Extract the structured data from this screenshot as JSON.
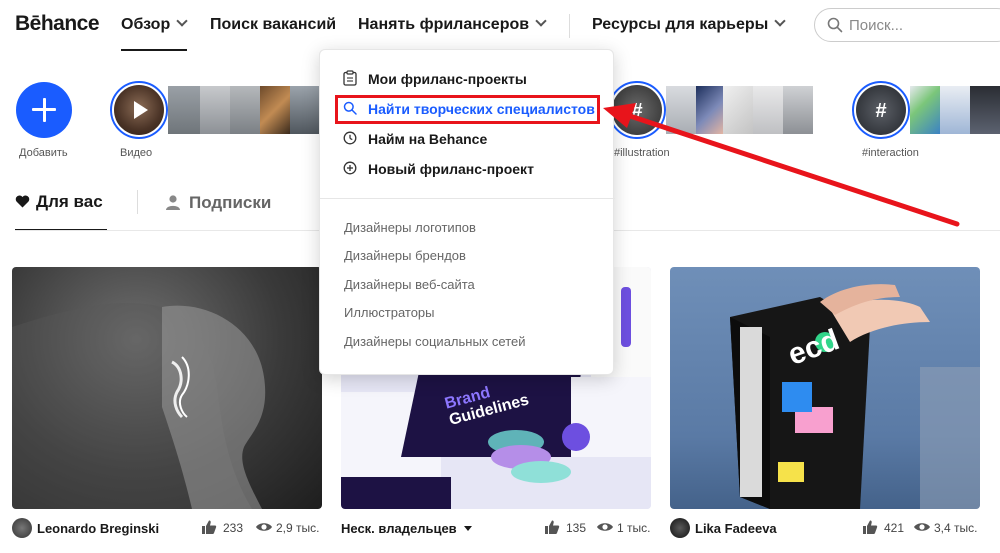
{
  "header": {
    "logo": "Bēhance",
    "nav": {
      "browse": "Обзор",
      "jobs": "Поиск вакансий",
      "hire": "Нанять фрилансеров",
      "career": "Ресурсы для карьеры"
    },
    "search_placeholder": "Поиск..."
  },
  "stories": {
    "add_label": "Добавить",
    "video_label": "Видео",
    "illustration_label": "#illustration",
    "interaction_label": "#interaction"
  },
  "tabs": {
    "for_you": "Для вас",
    "following": "Подписки"
  },
  "dropdown": {
    "items": [
      {
        "label": "Мои фриланс-проекты",
        "icon": "clipboard-icon"
      },
      {
        "label": "Найти творческих специалистов",
        "icon": "search-icon"
      },
      {
        "label": "Найм на Behance",
        "icon": "clock-icon"
      },
      {
        "label": "Новый фриланс-проект",
        "icon": "plus-circle-icon"
      }
    ],
    "subitems": [
      "Дизайнеры логотипов",
      "Дизайнеры брендов",
      "Дизайнеры веб-сайта",
      "Иллюстраторы",
      "Дизайнеры социальных сетей"
    ]
  },
  "cards": [
    {
      "owner": "Leonardo Breginski",
      "likes": "233",
      "views": "2,9 тыс."
    },
    {
      "owner": "Неск. владельцев",
      "likes": "135",
      "views": "1 тыс."
    },
    {
      "owner": "Lika Fadeeva",
      "likes": "421",
      "views": "3,4 тыс."
    }
  ],
  "card2_text": {
    "line1": "Brand",
    "line2": "Guidelines"
  },
  "card3_text": {
    "brand": "ecd"
  },
  "colors": {
    "accent_blue": "#1a5cff",
    "highlight_red": "#e8141b"
  }
}
